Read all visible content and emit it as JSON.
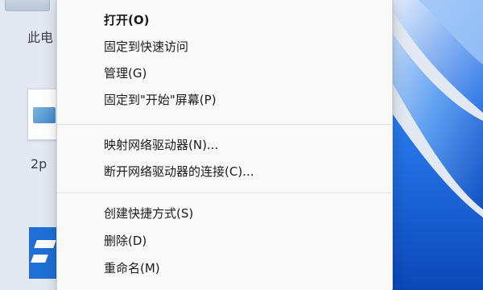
{
  "desktop": {
    "icons": [
      {
        "name": "this-pc",
        "label": "此电"
      },
      {
        "name": "document",
        "label": "2p"
      },
      {
        "name": "app",
        "label": ""
      }
    ],
    "colors": {
      "wallpaper_blue": "#1e63d6",
      "wallpaper_light": "#bcd6f5"
    }
  },
  "context_menu": {
    "items": [
      {
        "label": "打开(O)",
        "bold": true
      },
      {
        "label": "固定到快速访问"
      },
      {
        "label": "管理(G)"
      },
      {
        "label": "固定到\"开始\"屏幕(P)"
      },
      {
        "label": "映射网络驱动器(N)..."
      },
      {
        "label": "断开网络驱动器的连接(C)..."
      },
      {
        "label": "创建快捷方式(S)"
      },
      {
        "label": "删除(D)"
      },
      {
        "label": "重命名(M)"
      }
    ]
  }
}
